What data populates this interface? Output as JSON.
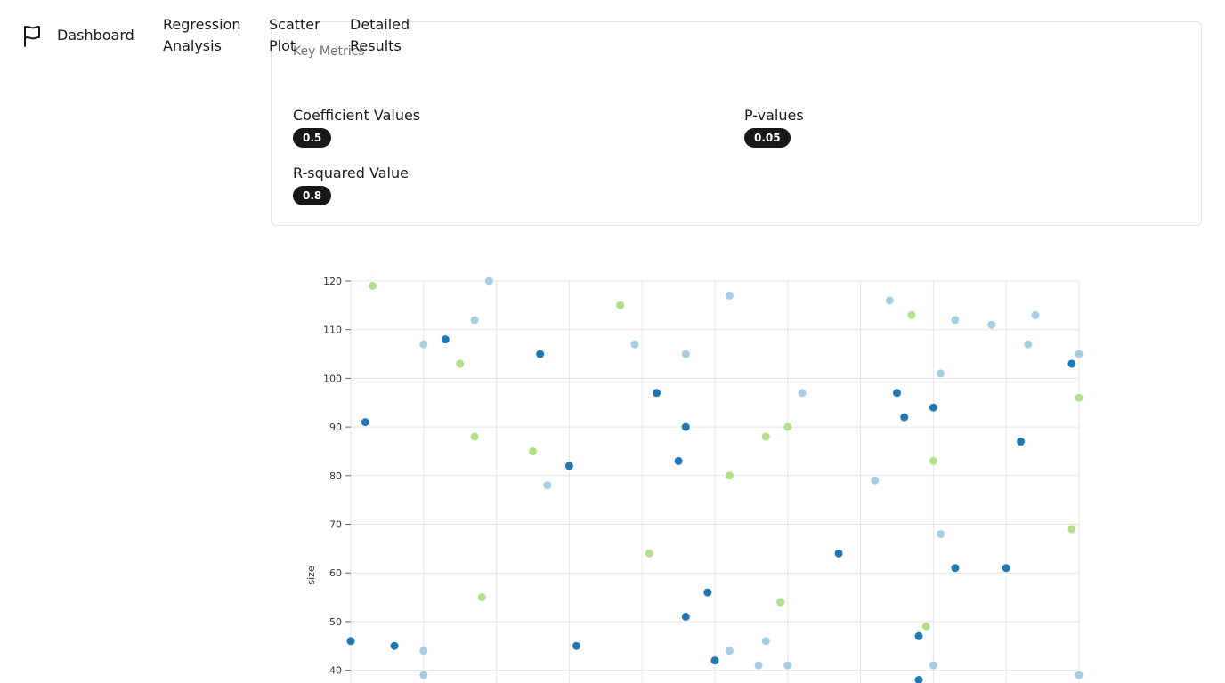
{
  "nav": {
    "brand_icon": "flag-icon",
    "items": [
      {
        "label": "Dashboard"
      },
      {
        "label": "Regression Analysis"
      },
      {
        "label": "Scatter Plot"
      },
      {
        "label": "Detailed Results"
      }
    ]
  },
  "metrics_card": {
    "title": "Key Metrics",
    "metrics": [
      {
        "label": "Coefficient Values",
        "value": "0.5"
      },
      {
        "label": "P-values",
        "value": "0.05"
      },
      {
        "label": "R-squared Value",
        "value": "0.8"
      }
    ]
  },
  "colors": {
    "dark_blue": "#1f78b4",
    "light_blue": "#a6cee3",
    "light_green": "#b2df8a",
    "badge_bg": "#18181b"
  },
  "chart_data": {
    "type": "scatter",
    "ylabel": "size",
    "yticks": [
      120,
      110,
      100,
      90,
      80,
      70,
      60,
      50,
      40
    ],
    "ylim": [
      38,
      120
    ],
    "xlim": [
      0,
      100
    ],
    "grid": true,
    "series": [
      {
        "color": "#1f78b4",
        "points": [
          {
            "x": 0,
            "y": 46
          },
          {
            "x": 2,
            "y": 91
          },
          {
            "x": 6,
            "y": 45
          },
          {
            "x": 13,
            "y": 108
          },
          {
            "x": 26,
            "y": 105
          },
          {
            "x": 30,
            "y": 82
          },
          {
            "x": 31,
            "y": 45
          },
          {
            "x": 42,
            "y": 97
          },
          {
            "x": 45,
            "y": 83
          },
          {
            "x": 46,
            "y": 90
          },
          {
            "x": 46,
            "y": 51
          },
          {
            "x": 49,
            "y": 56
          },
          {
            "x": 50,
            "y": 42
          },
          {
            "x": 67,
            "y": 64
          },
          {
            "x": 75,
            "y": 97
          },
          {
            "x": 76,
            "y": 92
          },
          {
            "x": 78,
            "y": 47
          },
          {
            "x": 78,
            "y": 38
          },
          {
            "x": 80,
            "y": 94
          },
          {
            "x": 83,
            "y": 61
          },
          {
            "x": 90,
            "y": 61
          },
          {
            "x": 92,
            "y": 87
          },
          {
            "x": 99,
            "y": 103
          }
        ]
      },
      {
        "color": "#a6cee3",
        "points": [
          {
            "x": 10,
            "y": 107
          },
          {
            "x": 10,
            "y": 44
          },
          {
            "x": 10,
            "y": 39
          },
          {
            "x": 17,
            "y": 112
          },
          {
            "x": 19,
            "y": 120
          },
          {
            "x": 27,
            "y": 78
          },
          {
            "x": 39,
            "y": 107
          },
          {
            "x": 46,
            "y": 105
          },
          {
            "x": 52,
            "y": 117
          },
          {
            "x": 52,
            "y": 44
          },
          {
            "x": 56,
            "y": 41
          },
          {
            "x": 57,
            "y": 46
          },
          {
            "x": 60,
            "y": 41
          },
          {
            "x": 62,
            "y": 97
          },
          {
            "x": 72,
            "y": 79
          },
          {
            "x": 74,
            "y": 116
          },
          {
            "x": 80,
            "y": 41
          },
          {
            "x": 81,
            "y": 101
          },
          {
            "x": 81,
            "y": 68
          },
          {
            "x": 83,
            "y": 112
          },
          {
            "x": 88,
            "y": 111
          },
          {
            "x": 93,
            "y": 107
          },
          {
            "x": 94,
            "y": 113
          },
          {
            "x": 100,
            "y": 105
          },
          {
            "x": 100,
            "y": 39
          }
        ]
      },
      {
        "color": "#b2df8a",
        "points": [
          {
            "x": 3,
            "y": 119
          },
          {
            "x": 15,
            "y": 103
          },
          {
            "x": 17,
            "y": 88
          },
          {
            "x": 18,
            "y": 55
          },
          {
            "x": 25,
            "y": 85
          },
          {
            "x": 37,
            "y": 115
          },
          {
            "x": 41,
            "y": 64
          },
          {
            "x": 52,
            "y": 80
          },
          {
            "x": 57,
            "y": 88
          },
          {
            "x": 59,
            "y": 54
          },
          {
            "x": 60,
            "y": 90
          },
          {
            "x": 77,
            "y": 113
          },
          {
            "x": 79,
            "y": 49
          },
          {
            "x": 80,
            "y": 83
          },
          {
            "x": 99,
            "y": 69
          },
          {
            "x": 100,
            "y": 96
          }
        ]
      }
    ]
  }
}
